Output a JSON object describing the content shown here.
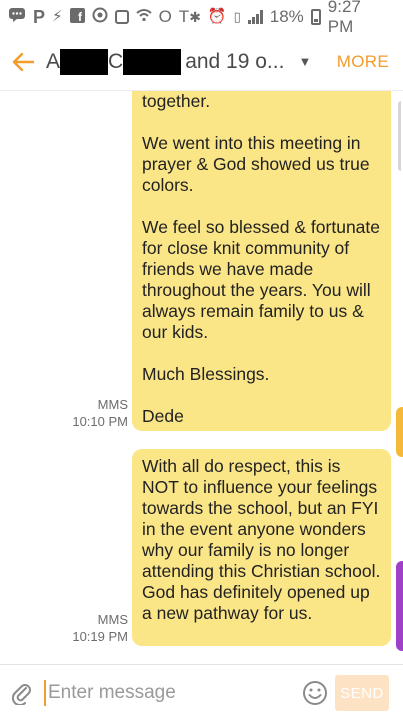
{
  "status_bar": {
    "battery": "18%",
    "time": "9:27 PM",
    "icons": [
      "messages-icon",
      "parking-icon",
      "flash-icon",
      "facebook-icon",
      "camera-icon",
      "gallery-icon",
      "wifi-icon",
      "o-icon",
      "tf-icon",
      "bluetooth-icon",
      "alarm-icon",
      "vibrate-icon",
      "signal-icon",
      "battery-icon"
    ]
  },
  "header": {
    "title_initial_1": "A",
    "title_initial_2": "C",
    "title_suffix": "and 19 o...",
    "more_label": "MORE"
  },
  "messages": [
    {
      "paragraphs": [
        "together.",
        "We went into this meeting in prayer & God showed us true colors.",
        "We feel so blessed & fortunate for close knit community of friends we have made throughout the years. You will always remain family to us & our kids.",
        "Much Blessings.",
        "Dede"
      ],
      "type": "MMS",
      "time": "10:10 PM"
    },
    {
      "paragraphs": [
        "With all do respect, this is NOT to influence your feelings towards the school, but an FYI in the event anyone wonders why our family is no longer attending this Christian school. God has definitely opened up a new pathway for us."
      ],
      "type": "MMS",
      "time": "10:19 PM"
    }
  ],
  "composer": {
    "placeholder": "Enter message",
    "send_label": "SEND"
  },
  "colors": {
    "accent": "#f39c2c",
    "bubble": "#fbe687",
    "edge_tab_1": "#f5b93a",
    "edge_tab_2": "#a040c8"
  }
}
